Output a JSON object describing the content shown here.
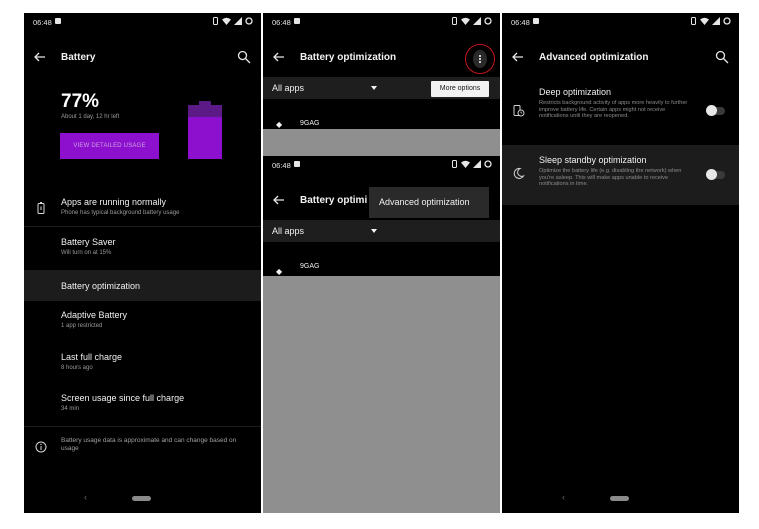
{
  "status": {
    "time": "06:48"
  },
  "screen1": {
    "title": "Battery",
    "percent": "77%",
    "time_left": "About 1 day, 12 hr left",
    "detail_button": "VIEW DETAILED USAGE",
    "battery_level": 0.77,
    "items": [
      {
        "title": "Apps are running normally",
        "subtitle": "Phone has typical background battery usage"
      },
      {
        "title": "Battery Saver",
        "subtitle": "Will turn on at 15%"
      },
      {
        "title": "Battery optimization",
        "subtitle": ""
      },
      {
        "title": "Adaptive Battery",
        "subtitle": "1 app restricted"
      },
      {
        "title": "Last full charge",
        "subtitle": "8 hours ago"
      },
      {
        "title": "Screen usage since full charge",
        "subtitle": "34 min"
      }
    ],
    "footer_note": "Battery usage data is approximate and can change based on usage"
  },
  "screen2": {
    "title": "Battery optimization",
    "title_truncated": "Battery optimi",
    "filter": "All apps",
    "more_options": "More options",
    "app_name": "9GAG",
    "menu_item": "Advanced optimization"
  },
  "screen3": {
    "title": "Advanced optimization",
    "options": [
      {
        "title": "Deep optimization",
        "desc": "Restricts background activity of apps more heavily to further improve battery life. Certain apps might not receive notifications until they are reopened.",
        "enabled": false
      },
      {
        "title": "Sleep standby optimization",
        "desc": "Optimize the battery life (e.g. disabling the network) when you're asleep. This will make apps unable to receive notifications in time.",
        "enabled": false
      }
    ]
  },
  "colors": {
    "accent": "#8e10cf",
    "highlight_ring": "#c3141d"
  }
}
